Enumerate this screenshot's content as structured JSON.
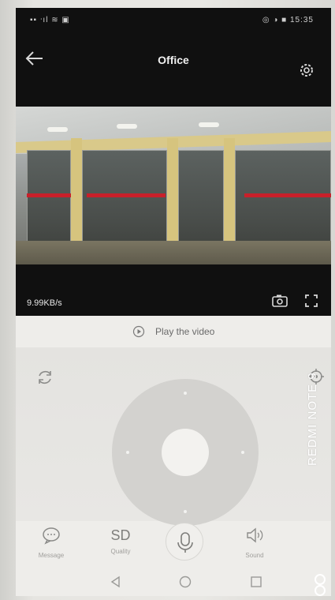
{
  "status_bar": {
    "left": "▪▪ ᐧıl ≋ ▣",
    "right": "◎ ◑ ■ 15:35"
  },
  "header": {
    "title": "Office"
  },
  "video": {
    "bitrate": "9.99KB/s"
  },
  "playback": {
    "label": "Play the video"
  },
  "toolbar": {
    "message_label": "Message",
    "quality_value": "SD",
    "quality_label": "Quality",
    "sound_label": "Sound"
  },
  "watermark": {
    "text": "REDMI NOTE 9"
  },
  "colors": {
    "dark_bg": "#101010",
    "panel_bg": "#eeedea",
    "joystick": "#d3d2cf"
  }
}
